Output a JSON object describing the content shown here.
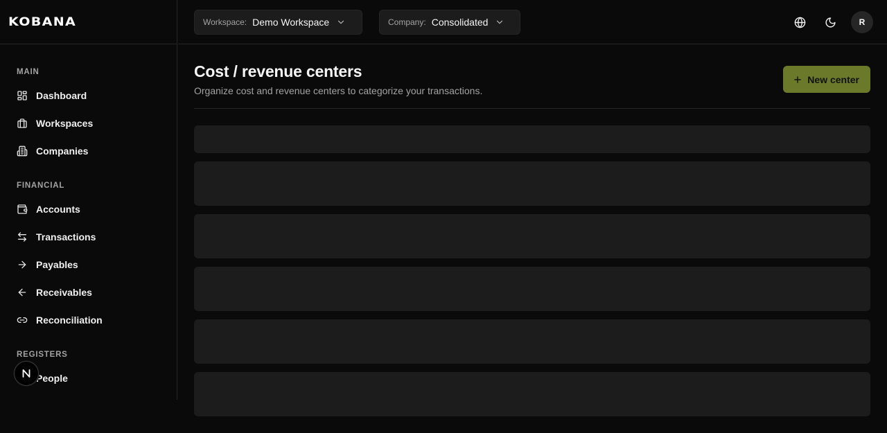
{
  "brand": {
    "name": "KOBANA"
  },
  "header": {
    "workspace": {
      "label": "Workspace:",
      "value": "Demo Workspace"
    },
    "company": {
      "label": "Company:",
      "value": "Consolidated"
    },
    "avatar_initial": "R"
  },
  "sidebar": {
    "sections": [
      {
        "title": "MAIN",
        "items": [
          {
            "label": "Dashboard",
            "icon": "dashboard-icon"
          },
          {
            "label": "Workspaces",
            "icon": "briefcase-icon"
          },
          {
            "label": "Companies",
            "icon": "building-icon"
          }
        ]
      },
      {
        "title": "FINANCIAL",
        "items": [
          {
            "label": "Accounts",
            "icon": "wallet-icon"
          },
          {
            "label": "Transactions",
            "icon": "arrows-left-right-icon"
          },
          {
            "label": "Payables",
            "icon": "arrow-right-icon"
          },
          {
            "label": "Receivables",
            "icon": "arrow-left-icon"
          },
          {
            "label": "Reconciliation",
            "icon": "link-icon"
          }
        ]
      },
      {
        "title": "REGISTERS",
        "items": [
          {
            "label": "People",
            "icon": "users-icon"
          }
        ]
      }
    ]
  },
  "page": {
    "title": "Cost / revenue centers",
    "subtitle": "Organize cost and revenue centers to categorize your transactions.",
    "new_button_label": "New center"
  },
  "colors": {
    "accent": "#6b7a2a",
    "background": "#0a0a0a",
    "skeleton": "#1c1c1c"
  }
}
